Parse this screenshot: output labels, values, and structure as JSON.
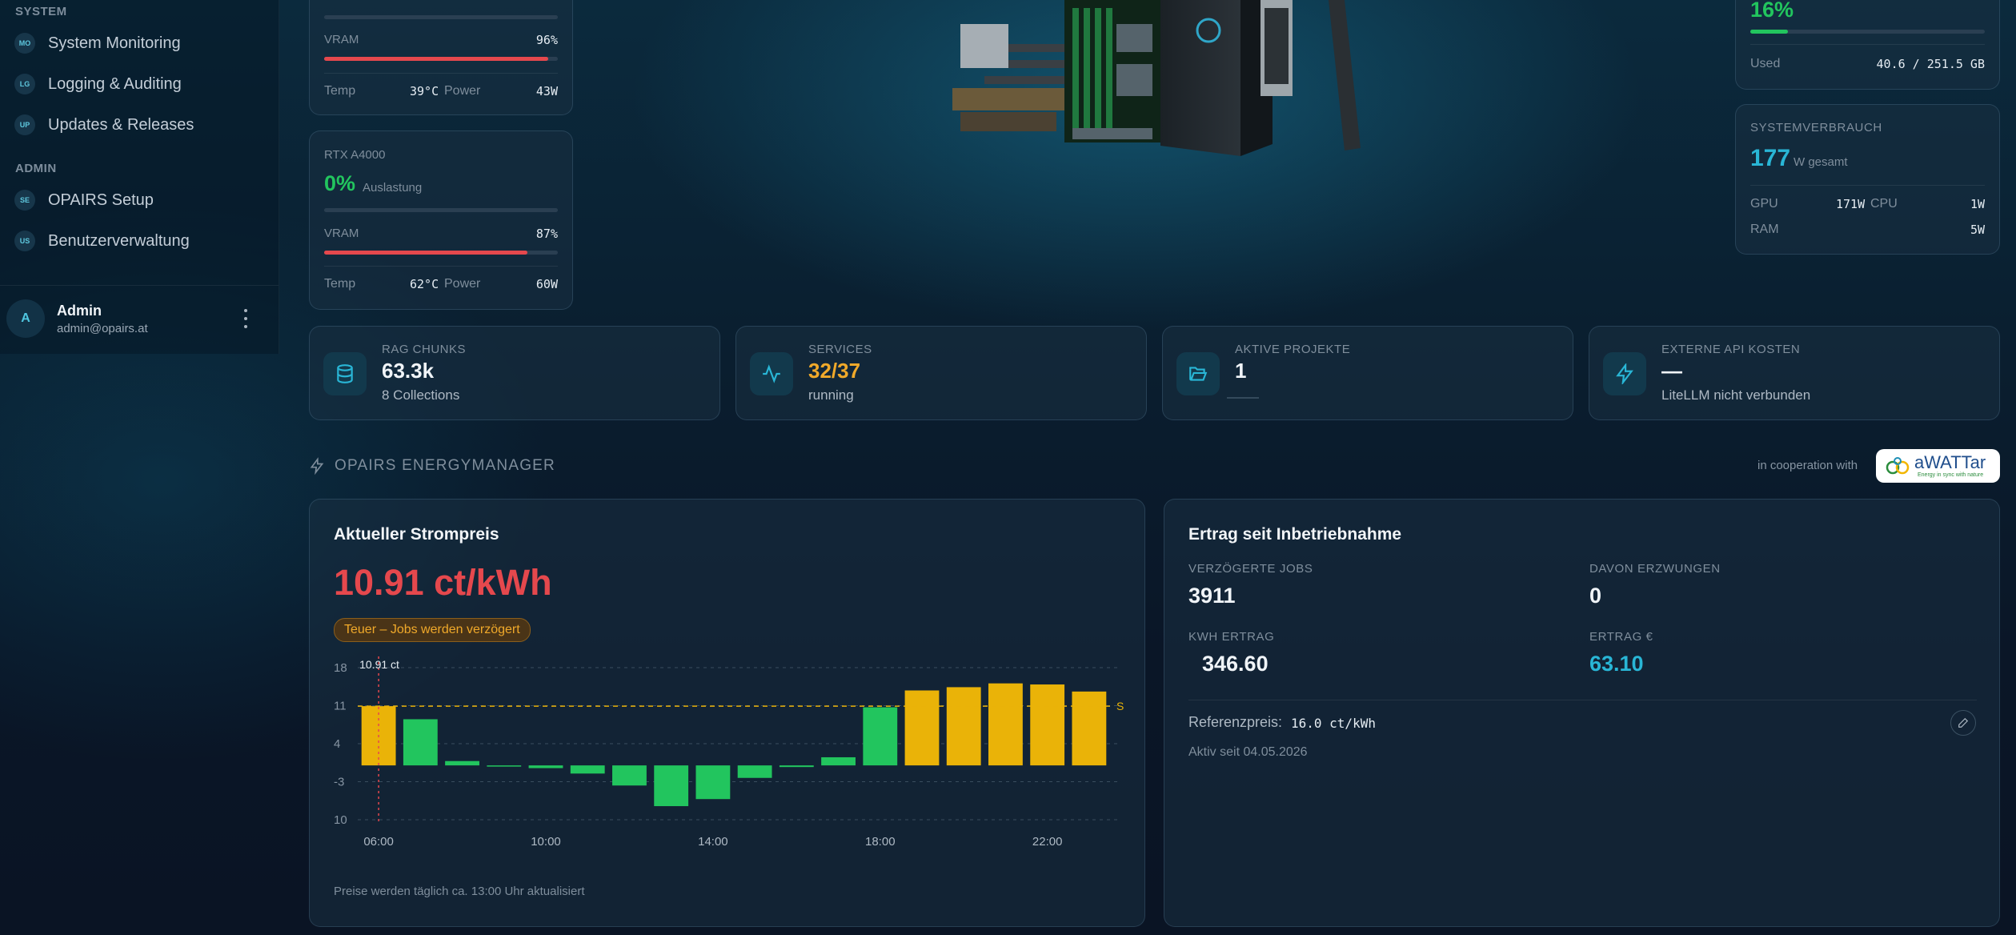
{
  "sidebar": {
    "sections": [
      {
        "title": "SYSTEM",
        "items": [
          {
            "badge": "MO",
            "label": "System Monitoring"
          },
          {
            "badge": "LG",
            "label": "Logging & Auditing"
          },
          {
            "badge": "UP",
            "label": "Updates & Releases"
          }
        ]
      },
      {
        "title": "ADMIN",
        "items": [
          {
            "badge": "SE",
            "label": "OPAIRS Setup"
          },
          {
            "badge": "US",
            "label": "Benutzerverwaltung"
          }
        ]
      }
    ],
    "user": {
      "initial": "A",
      "name": "Admin",
      "email": "admin@opairs.at"
    }
  },
  "gpu_partial": {
    "vram_label": "VRAM",
    "vram_value": "96%",
    "vram_fraction": 0.96,
    "temp_label": "Temp",
    "temp_value": "39°C",
    "power_label": "Power",
    "power_value": "43W"
  },
  "gpu_a4000": {
    "name": "RTX A4000",
    "util_value": "0%",
    "util_label": "Auslastung",
    "util_fraction": 0.0,
    "vram_label": "VRAM",
    "vram_value": "87%",
    "vram_fraction": 0.87,
    "temp_label": "Temp",
    "temp_value": "62°C",
    "power_label": "Power",
    "power_value": "60W"
  },
  "storage": {
    "percent": "16%",
    "fraction": 0.16,
    "used_label": "Used",
    "used_value": "40.6 / 251.5 GB"
  },
  "power_card": {
    "title": "SYSTEMVERBRAUCH",
    "total": "177",
    "total_unit": "W gesamt",
    "gpu_label": "GPU",
    "gpu_value": "171W",
    "cpu_label": "CPU",
    "cpu_value": "1W",
    "ram_label": "RAM",
    "ram_value": "5W"
  },
  "stats": [
    {
      "icon": "database-icon",
      "label": "RAG CHUNKS",
      "value": "63.3k",
      "sub": "8 Collections",
      "color": "#f0f4f8"
    },
    {
      "icon": "activity-icon",
      "label": "SERVICES",
      "value": "32/37",
      "sub": "running",
      "color": "#f0a92a"
    },
    {
      "icon": "folder-open-icon",
      "label": "AKTIVE PROJEKTE",
      "value": "1",
      "sub": "",
      "color": "#f0f4f8"
    },
    {
      "icon": "lightning-icon",
      "label": "EXTERNE API KOSTEN",
      "value": "—",
      "sub": "LiteLLM nicht verbunden",
      "color": "#f0f4f8"
    }
  ],
  "energy": {
    "section_title": "OPAIRS ENERGYMANAGER",
    "cooperation": "in cooperation with",
    "partner_logo": "aWATTar",
    "partner_tagline": "Energy in sync with nature",
    "price_card": {
      "title": "Aktueller Strompreis",
      "price": "10.91 ct/kWh",
      "badge": "Teuer – Jobs werden verzögert",
      "footer": "Preise werden täglich ca. 13:00 Uhr aktualisiert"
    },
    "yield_card": {
      "title": "Ertrag seit Inbetriebnahme",
      "delayed_label": "VERZÖGERTE JOBS",
      "delayed_value": "3911",
      "forced_label": "DAVON ERZWUNGEN",
      "forced_value": "0",
      "kwh_label": "KWH ERTRAG",
      "kwh_value": "346.60",
      "euro_label": "ERTRAG €",
      "euro_value": "63.10",
      "ref_label": "Referenzpreis:",
      "ref_value": "16.0 ct/kWh",
      "active_since": "Aktiv seit 04.05.2026"
    }
  },
  "colors": {
    "accent": "#29b6d6",
    "red": "#e5484d",
    "green": "#22c55e",
    "amber": "#eab308",
    "orange": "#f0a92a"
  },
  "chart_data": {
    "type": "bar",
    "x": [
      "06:00",
      "07:00",
      "08:00",
      "09:00",
      "10:00",
      "11:00",
      "12:00",
      "13:00",
      "14:00",
      "15:00",
      "16:00",
      "17:00",
      "18:00",
      "19:00",
      "20:00",
      "21:00",
      "22:00",
      "23:00"
    ],
    "values": [
      10.91,
      8.5,
      0.8,
      -0.1,
      -0.5,
      -1.5,
      -3.7,
      -7.5,
      -6.2,
      -2.3,
      -0.3,
      1.5,
      10.7,
      13.8,
      14.4,
      15.1,
      14.9,
      13.6
    ],
    "highlight_color": "#eab308",
    "low_color": "#22c55e",
    "threshold": 10.91,
    "threshold_label": "S",
    "current_label": "10.91 ct",
    "y_ticks": [
      "18",
      "11",
      "4",
      "-3",
      "10"
    ],
    "y_tick_values": [
      18,
      11,
      4,
      -3,
      -10
    ],
    "x_ticks": [
      "06:00",
      "10:00",
      "14:00",
      "18:00",
      "22:00"
    ],
    "ylim": [
      -10,
      18
    ],
    "grid": true
  }
}
